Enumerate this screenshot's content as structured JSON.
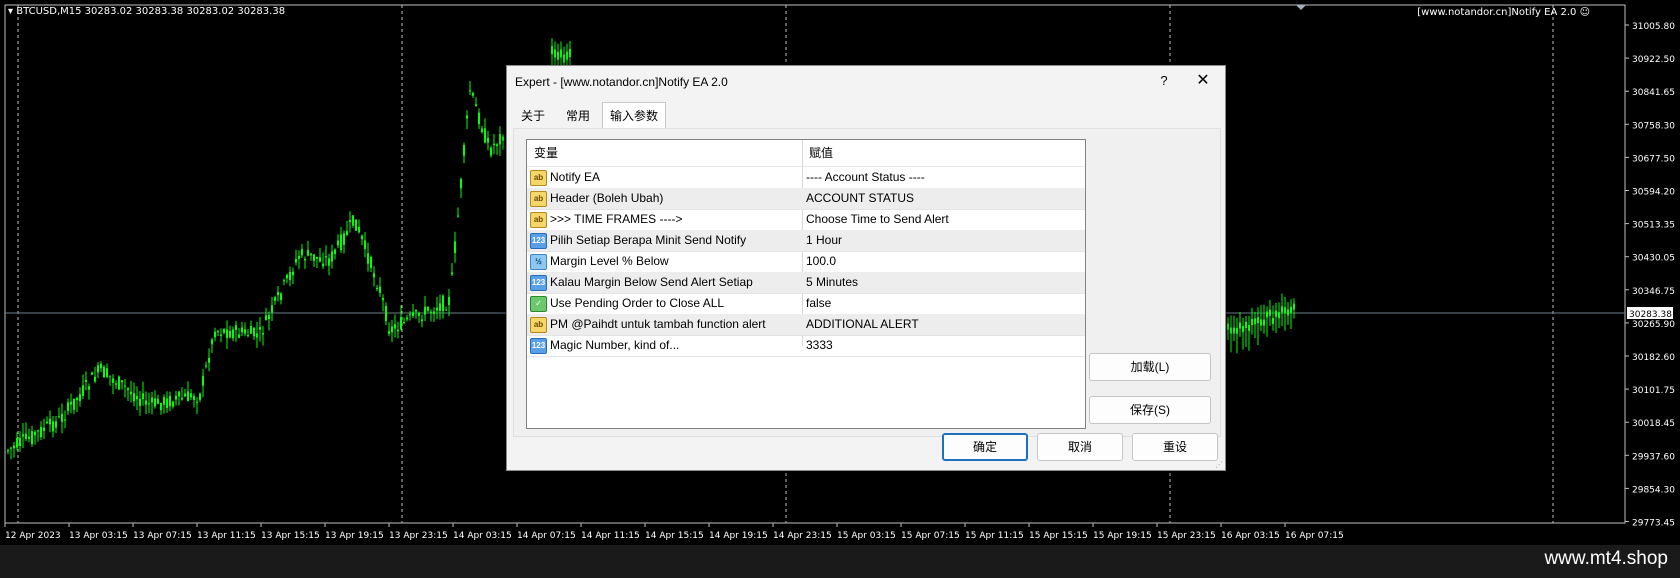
{
  "chart": {
    "symbol_line": "BTCUSD,M15  30283.02 30283.38 30283.02 30283.38",
    "ea_label": "[www.notandor.cn]Notify EA 2.0",
    "current_price": "30283.38",
    "price_ticks": [
      "31005.80",
      "30922.50",
      "30841.65",
      "30758.30",
      "30677.50",
      "30594.20",
      "30513.35",
      "30430.05",
      "30346.75",
      "30265.90",
      "30182.60",
      "30101.75",
      "30018.45",
      "29937.60",
      "29854.30",
      "29773.45"
    ],
    "time_ticks": [
      "12 Apr 2023",
      "13 Apr 03:15",
      "13 Apr 07:15",
      "13 Apr 11:15",
      "13 Apr 15:15",
      "13 Apr 19:15",
      "13 Apr 23:15",
      "14 Apr 03:15",
      "14 Apr 07:15",
      "14 Apr 11:15",
      "14 Apr 15:15",
      "14 Apr 19:15",
      "14 Apr 23:15",
      "15 Apr 03:15",
      "15 Apr 07:15",
      "15 Apr 11:15",
      "15 Apr 15:15",
      "15 Apr 19:15",
      "15 Apr 23:15",
      "16 Apr 03:15",
      "16 Apr 07:15"
    ],
    "colors": {
      "candle": "#00ff00",
      "grid": "#c0c0c0",
      "bid_line": "#6b7d8c"
    }
  },
  "watermark": "www.mt4.shop",
  "dialog": {
    "title": "Expert - [www.notandor.cn]Notify EA 2.0",
    "help": "?",
    "close": "✕",
    "tabs": [
      {
        "label": "关于"
      },
      {
        "label": "常用"
      },
      {
        "label": "输入参数",
        "active": true
      }
    ],
    "grid": {
      "col_variable": "变量",
      "col_value": "赋值",
      "rows": [
        {
          "icon": "ab",
          "name": "Notify EA",
          "value": "---- Account Status ----"
        },
        {
          "icon": "ab",
          "name": "Header (Boleh Ubah)",
          "value": "ACCOUNT STATUS"
        },
        {
          "icon": "ab",
          "name": ">>> TIME FRAMES ---->",
          "value": "Choose Time to Send Alert"
        },
        {
          "icon": "123",
          "name": "Pilih Setiap Berapa Minit Send Notify",
          "value": "1 Hour"
        },
        {
          "icon": "½",
          "name": "Margin Level % Below",
          "value": "100.0"
        },
        {
          "icon": "123",
          "name": "Kalau Margin Below Send Alert Setiap",
          "value": "5 Minutes"
        },
        {
          "icon": "bool",
          "name": "Use Pending Order to Close ALL",
          "value": "false"
        },
        {
          "icon": "ab",
          "name": "PM @Paihdt untuk tambah function alert",
          "value": "ADDITIONAL ALERT"
        },
        {
          "icon": "123",
          "name": "Magic Number, kind of...",
          "value": "3333"
        }
      ]
    },
    "buttons": {
      "load": "加载(L)",
      "save": "保存(S)",
      "ok": "确定",
      "cancel": "取消",
      "reset": "重设"
    }
  }
}
